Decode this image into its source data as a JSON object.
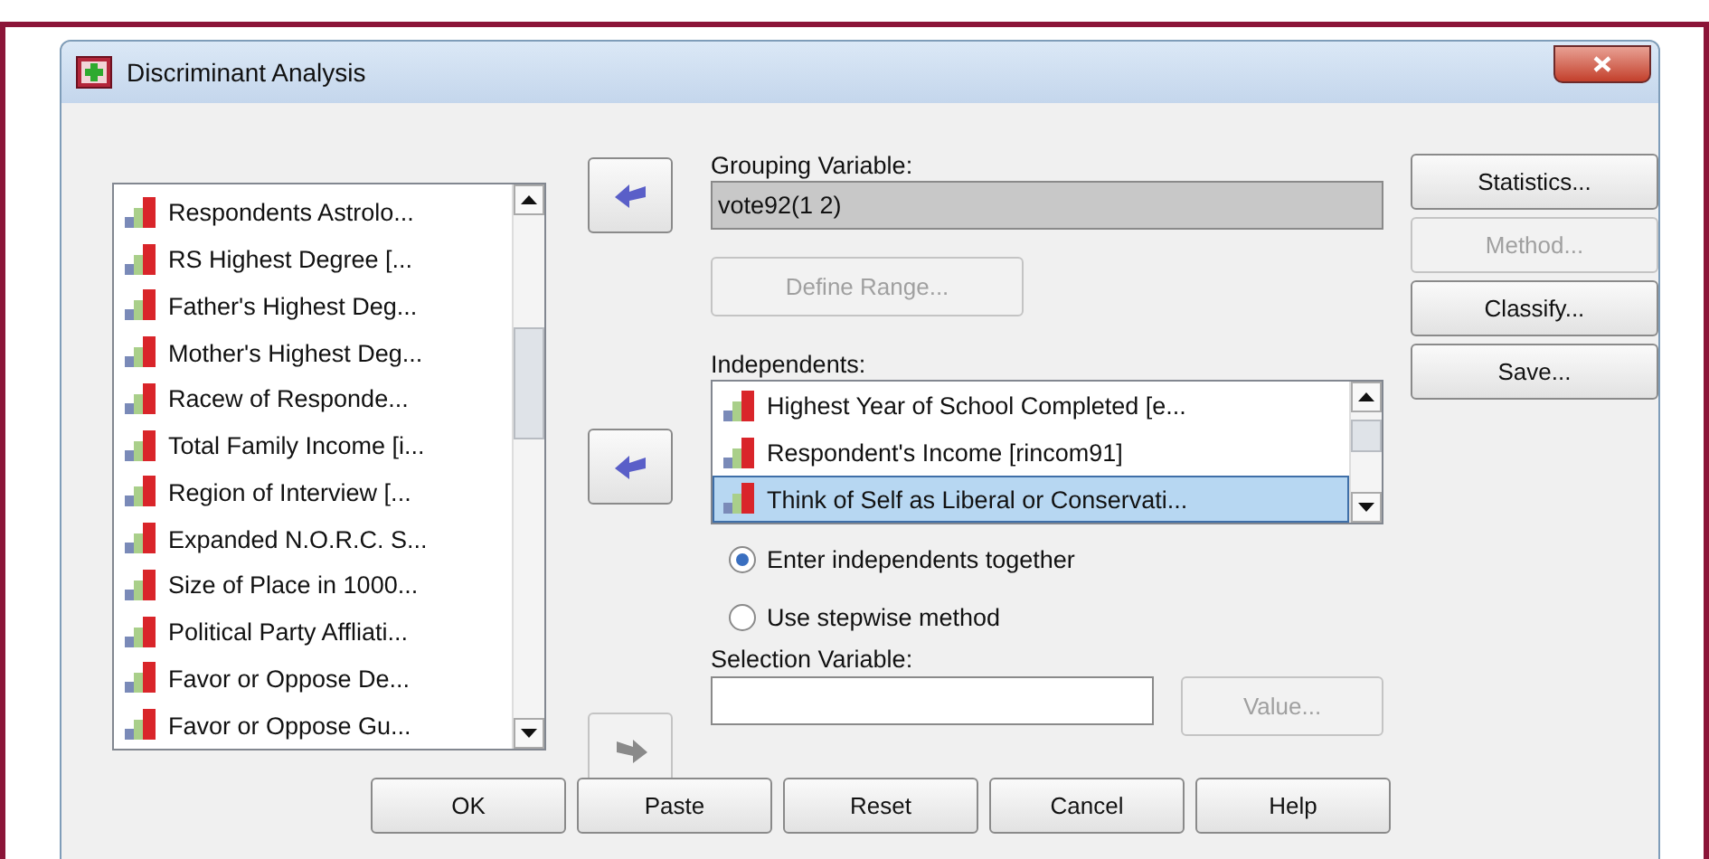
{
  "window": {
    "title": "Discriminant Analysis"
  },
  "variables": {
    "items": [
      {
        "label": "Respondents Astrolo...",
        "selected": false
      },
      {
        "label": "RS Highest Degree [...",
        "selected": false
      },
      {
        "label": "Father's Highest Deg...",
        "selected": false
      },
      {
        "label": "Mother's Highest Deg...",
        "selected": false
      },
      {
        "label": "Racew of Responde...",
        "selected": false
      },
      {
        "label": "Total Family Income [i...",
        "selected": false
      },
      {
        "label": "Region of Interview [...",
        "selected": false
      },
      {
        "label": "Expanded N.O.R.C. S...",
        "selected": false
      },
      {
        "label": "Size of Place in 1000...",
        "selected": false
      },
      {
        "label": "Political Party Affliati...",
        "selected": false
      },
      {
        "label": "Favor or Oppose De...",
        "selected": false
      },
      {
        "label": "Favor or Oppose Gu...",
        "selected": false
      }
    ]
  },
  "grouping": {
    "label": "Grouping Variable:",
    "value": "vote92(1 2)"
  },
  "define_range": {
    "label": "Define Range...",
    "disabled": true
  },
  "independents": {
    "label": "Independents:",
    "items": [
      {
        "label": "Highest Year of School Completed [e...",
        "selected": false
      },
      {
        "label": "Respondent's Income [rincom91]",
        "selected": false
      },
      {
        "label": "Think of Self as Liberal or Conservati...",
        "selected": true
      }
    ]
  },
  "method": [
    {
      "label": "Enter independents together",
      "selected": true
    },
    {
      "label": "Use stepwise method",
      "selected": false
    }
  ],
  "selection": {
    "label": "Selection Variable:",
    "value_button": {
      "label": "Value...",
      "disabled": true
    }
  },
  "side_buttons": [
    {
      "label": "Statistics...",
      "disabled": false
    },
    {
      "label": "Method...",
      "disabled": true
    },
    {
      "label": "Classify...",
      "disabled": false
    },
    {
      "label": "Save...",
      "disabled": false
    }
  ],
  "arrow_buttons": [
    {
      "kind": "left",
      "disabled": false
    },
    {
      "kind": "left",
      "disabled": false
    },
    {
      "kind": "right",
      "disabled": true
    }
  ],
  "bottom_buttons": [
    {
      "label": "OK"
    },
    {
      "label": "Paste"
    },
    {
      "label": "Reset"
    },
    {
      "label": "Cancel"
    },
    {
      "label": "Help"
    }
  ]
}
